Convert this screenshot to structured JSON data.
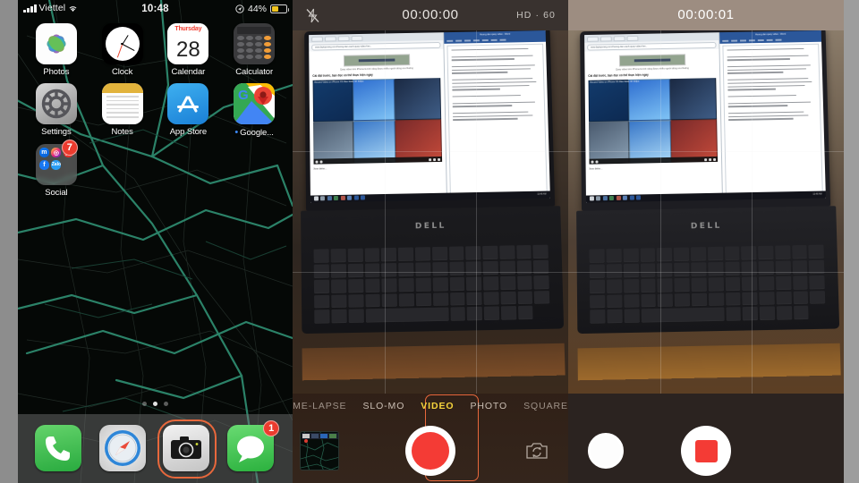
{
  "phone": {
    "statusbar": {
      "carrier": "Viettel",
      "time": "10:48",
      "battery_percent": "44%",
      "signal_icon": "signal-bars-icon",
      "wifi_icon": "wifi-icon",
      "location_icon": "location-arrow-icon",
      "battery_icon": "battery-icon"
    },
    "apps_rows": [
      [
        {
          "label": "Photos",
          "icon": "photos-icon"
        },
        {
          "label": "Clock",
          "icon": "clock-icon"
        },
        {
          "label": "Calendar",
          "icon": "calendar-icon",
          "weekday": "Thursday",
          "day": "28"
        },
        {
          "label": "Calculator",
          "icon": "calculator-icon"
        }
      ],
      [
        {
          "label": "Settings",
          "icon": "settings-gear-icon"
        },
        {
          "label": "Notes",
          "icon": "notes-icon"
        },
        {
          "label": "App Store",
          "icon": "app-store-icon"
        },
        {
          "label": "Google...",
          "icon": "google-maps-icon"
        }
      ],
      [
        {
          "label": "Social",
          "icon": "folder-icon",
          "badge": "7",
          "mini_icons": [
            "messenger-icon",
            "instagram-icon",
            "youtube-icon",
            "facebook-icon",
            "zalo-icon"
          ]
        }
      ]
    ],
    "page_dots": {
      "count": 3,
      "active_index": 1
    },
    "dock": [
      {
        "label": "Phone",
        "icon": "phone-icon",
        "selected": false
      },
      {
        "label": "Safari",
        "icon": "safari-compass-icon",
        "selected": false
      },
      {
        "label": "Camera",
        "icon": "camera-icon",
        "selected": true
      },
      {
        "label": "Messages",
        "icon": "messages-bubble-icon",
        "badge": "1",
        "selected": false
      }
    ]
  },
  "camera_before": {
    "flash_icon": "flash-off-icon",
    "timer": "00:00:00",
    "quality_label": "HD · 60",
    "modes": [
      {
        "label": "ME-LAPSE",
        "active": false,
        "truncated": true
      },
      {
        "label": "SLO-MO",
        "active": false
      },
      {
        "label": "VIDEO",
        "active": true
      },
      {
        "label": "PHOTO",
        "active": false
      },
      {
        "label": "SQUARE",
        "active": false
      }
    ],
    "thumbnail_name": "last-photo-thumbnail",
    "shutter_name": "record-start-button",
    "shutter_shape": "circle",
    "flip_icon": "camera-flip-icon"
  },
  "camera_recording": {
    "timer": "00:00:01",
    "snapshot_name": "take-photo-while-recording-button",
    "shutter_name": "record-stop-button",
    "shutter_shape": "square"
  },
  "scene": {
    "laptop_brand": "DELL",
    "browser": {
      "url": "www.laptopvang.com/huong-dan-cach-quay-video-lien...",
      "caption": "Quay video trên iPhone là tính năng được nhiều người dùng ưa chuộng",
      "heading": "Cài đặt trước, bạn đọc có thể thực hiện ngay",
      "video_title": "Record Video on iPhone XS Max Wide 4K 60fps",
      "footer": "Xem thêm..."
    },
    "word": {
      "title": "Huong dan quay video - Word",
      "status": "Page 1 of 3"
    },
    "taskbar_clock": "10:48 AM"
  },
  "colors": {
    "accent_orange": "#e8683c",
    "mode_yellow": "#f5d33c",
    "record_red": "#f43b35",
    "badge_red": "#ec3b2e",
    "battery_yellow": "#f0c420",
    "map_road": "#2f8d71"
  }
}
